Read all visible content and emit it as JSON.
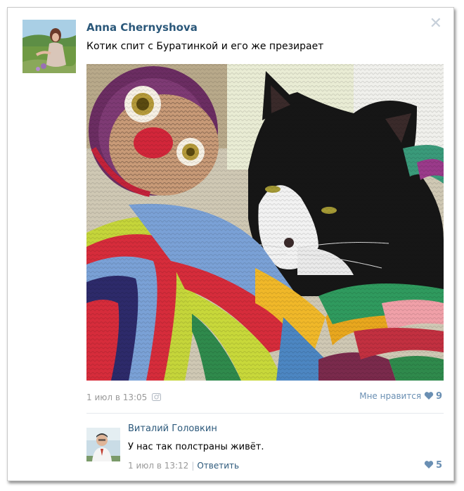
{
  "post": {
    "author": "Anna Chernyshova",
    "text": "Котик спит с Буратинкой и его же презирает",
    "date": "1 июл в 13:05",
    "like_label": "Мне нравится",
    "like_count": "9",
    "icons": [
      "close-icon",
      "camera-icon",
      "heart-icon"
    ]
  },
  "comment": {
    "author": "Виталий Головкин",
    "text": "У нас так полстраны живёт.",
    "date": "1 июл в 13:12",
    "reply_label": "Ответить",
    "like_count": "5"
  },
  "colors": {
    "link": "#2b587a",
    "meta": "#999999",
    "like": "#6a8fb3"
  }
}
